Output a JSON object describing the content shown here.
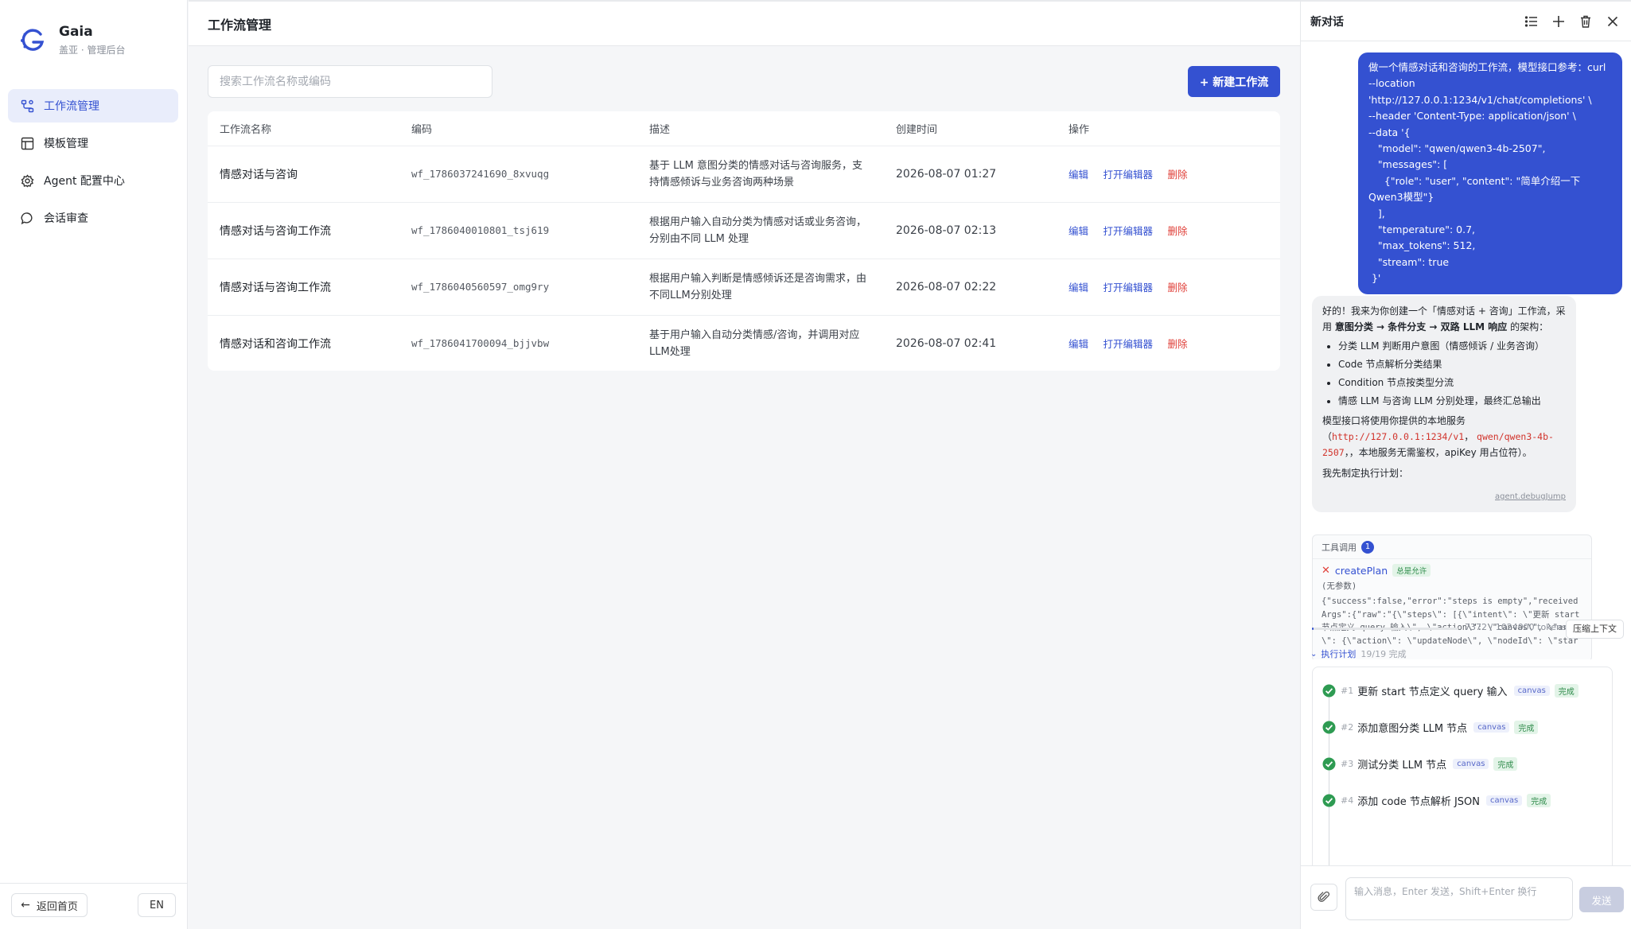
{
  "brand": {
    "name": "Gaia",
    "subtitle": "盖亚 · 管理后台"
  },
  "nav": {
    "items": [
      {
        "label": "工作流管理",
        "icon": "workflow-icon",
        "active": true
      },
      {
        "label": "模板管理",
        "icon": "template-icon",
        "active": false
      },
      {
        "label": "Agent 配置中心",
        "icon": "gear-icon",
        "active": false
      },
      {
        "label": "会话审查",
        "icon": "chat-bubble-icon",
        "active": false
      }
    ]
  },
  "sidebar_bottom": {
    "back_label": "返回首页",
    "lang_label": "EN"
  },
  "main": {
    "title": "工作流管理",
    "search_placeholder": "搜索工作流名称或编码",
    "new_button": "+ 新建工作流",
    "columns": [
      "工作流名称",
      "编码",
      "描述",
      "创建时间",
      "操作"
    ],
    "actions": {
      "edit": "编辑",
      "open_editor": "打开编辑器",
      "delete": "删除"
    },
    "rows": [
      {
        "name": "情感对话与咨询",
        "code": "wf_1786037241690_8xvuqg",
        "desc": "基于 LLM 意图分类的情感对话与咨询服务，支持情感倾诉与业务咨询两种场景",
        "time": "2026-08-07 01:27"
      },
      {
        "name": "情感对话与咨询工作流",
        "code": "wf_1786040010801_tsj619",
        "desc": "根据用户输入自动分类为情感对话或业务咨询，分别由不同 LLM 处理",
        "time": "2026-08-07 02:13"
      },
      {
        "name": "情感对话与咨询工作流",
        "code": "wf_1786040560597_omg9ry",
        "desc": "根据用户输入判断是情感倾诉还是咨询需求，由不同LLM分别处理",
        "time": "2026-08-07 02:22"
      },
      {
        "name": "情感对话和咨询工作流",
        "code": "wf_1786041700094_bjjvbw",
        "desc": "基于用户输入自动分类情感/咨询，并调用对应LLM处理",
        "time": "2026-08-07 02:41"
      }
    ]
  },
  "chat": {
    "title": "新对话",
    "user_message": "做一个情感对话和咨询的工作流，模型接口参考：curl\n--location\n'http://127.0.0.1:1234/v1/chat/completions' \\\n--header 'Content-Type: application/json' \\\n--data '{\n   \"model\": \"qwen/qwen3-4b-2507\",\n   \"messages\": [\n     {\"role\": \"user\", \"content\": \"简单介绍一下Qwen3模型\"}\n   ],\n   \"temperature\": 0.7,\n   \"max_tokens\": 512,\n   \"stream\": true\n }'",
    "bot": {
      "intro_prefix": "好的！我来为你创建一个「情感对话 + 咨询」工作流，采用 ",
      "intro_bold": "意图分类 → 条件分支 → 双路 LLM 响应",
      "intro_suffix": " 的架构：",
      "bullets": [
        "分类 LLM 判断用户意图（情感倾诉 / 业务咨询）",
        "Code 节点解析分类结果",
        "Condition 节点按类型分流",
        "情感 LLM 与咨询 LLM 分别处理，最终汇总输出"
      ],
      "model_line_prefix": "模型接口将使用你提供的本地服务",
      "model_url": "http://127.0.0.1:1234/v1",
      "model_name": "qwen/qwen3-4b-2507",
      "model_line_suffix": "，本地服务无需鉴权，apiKey 用占位符）。",
      "plan_line": "我先制定执行计划：",
      "debug_link": "agent.debugJump"
    },
    "tool_call": {
      "header": "工具调用",
      "count": "1",
      "name": "createPlan",
      "allow": "总是允许",
      "args": "(无参数)",
      "result": "{\"success\":false,\"error\":\"steps is empty\",\"receivedArgs\":{\"raw\":\"{\\\"steps\\\": [{\\\"intent\\\": \\\"更新 start 节点定义 query 输入\\\", \\\"action\\\": \\\"canvas\\\", \\\"args\\\": {\\\"action\\\": \\\"updateNode\\\", \\\"nodeId\\\": \\\"star"
    },
    "tokens": {
      "text": "7372 / 1024000 tokens",
      "fraction": 0.0072,
      "compress_label": "压缩上下文"
    },
    "plan": {
      "label": "执行计划",
      "count": "19/19 完成",
      "steps": [
        {
          "num": "#1",
          "text": "更新 start 节点定义 query 输入",
          "tag": "canvas",
          "status": "完成"
        },
        {
          "num": "#2",
          "text": "添加意图分类 LLM 节点",
          "tag": "canvas",
          "status": "完成"
        },
        {
          "num": "#3",
          "text": "测试分类 LLM 节点",
          "tag": "canvas",
          "status": "完成"
        },
        {
          "num": "#4",
          "text": "添加 code 节点解析 JSON",
          "tag": "canvas",
          "status": "完成"
        }
      ]
    },
    "input_placeholder": "输入消息，Enter 发送，Shift+Enter 换行",
    "send_label": "发送"
  }
}
